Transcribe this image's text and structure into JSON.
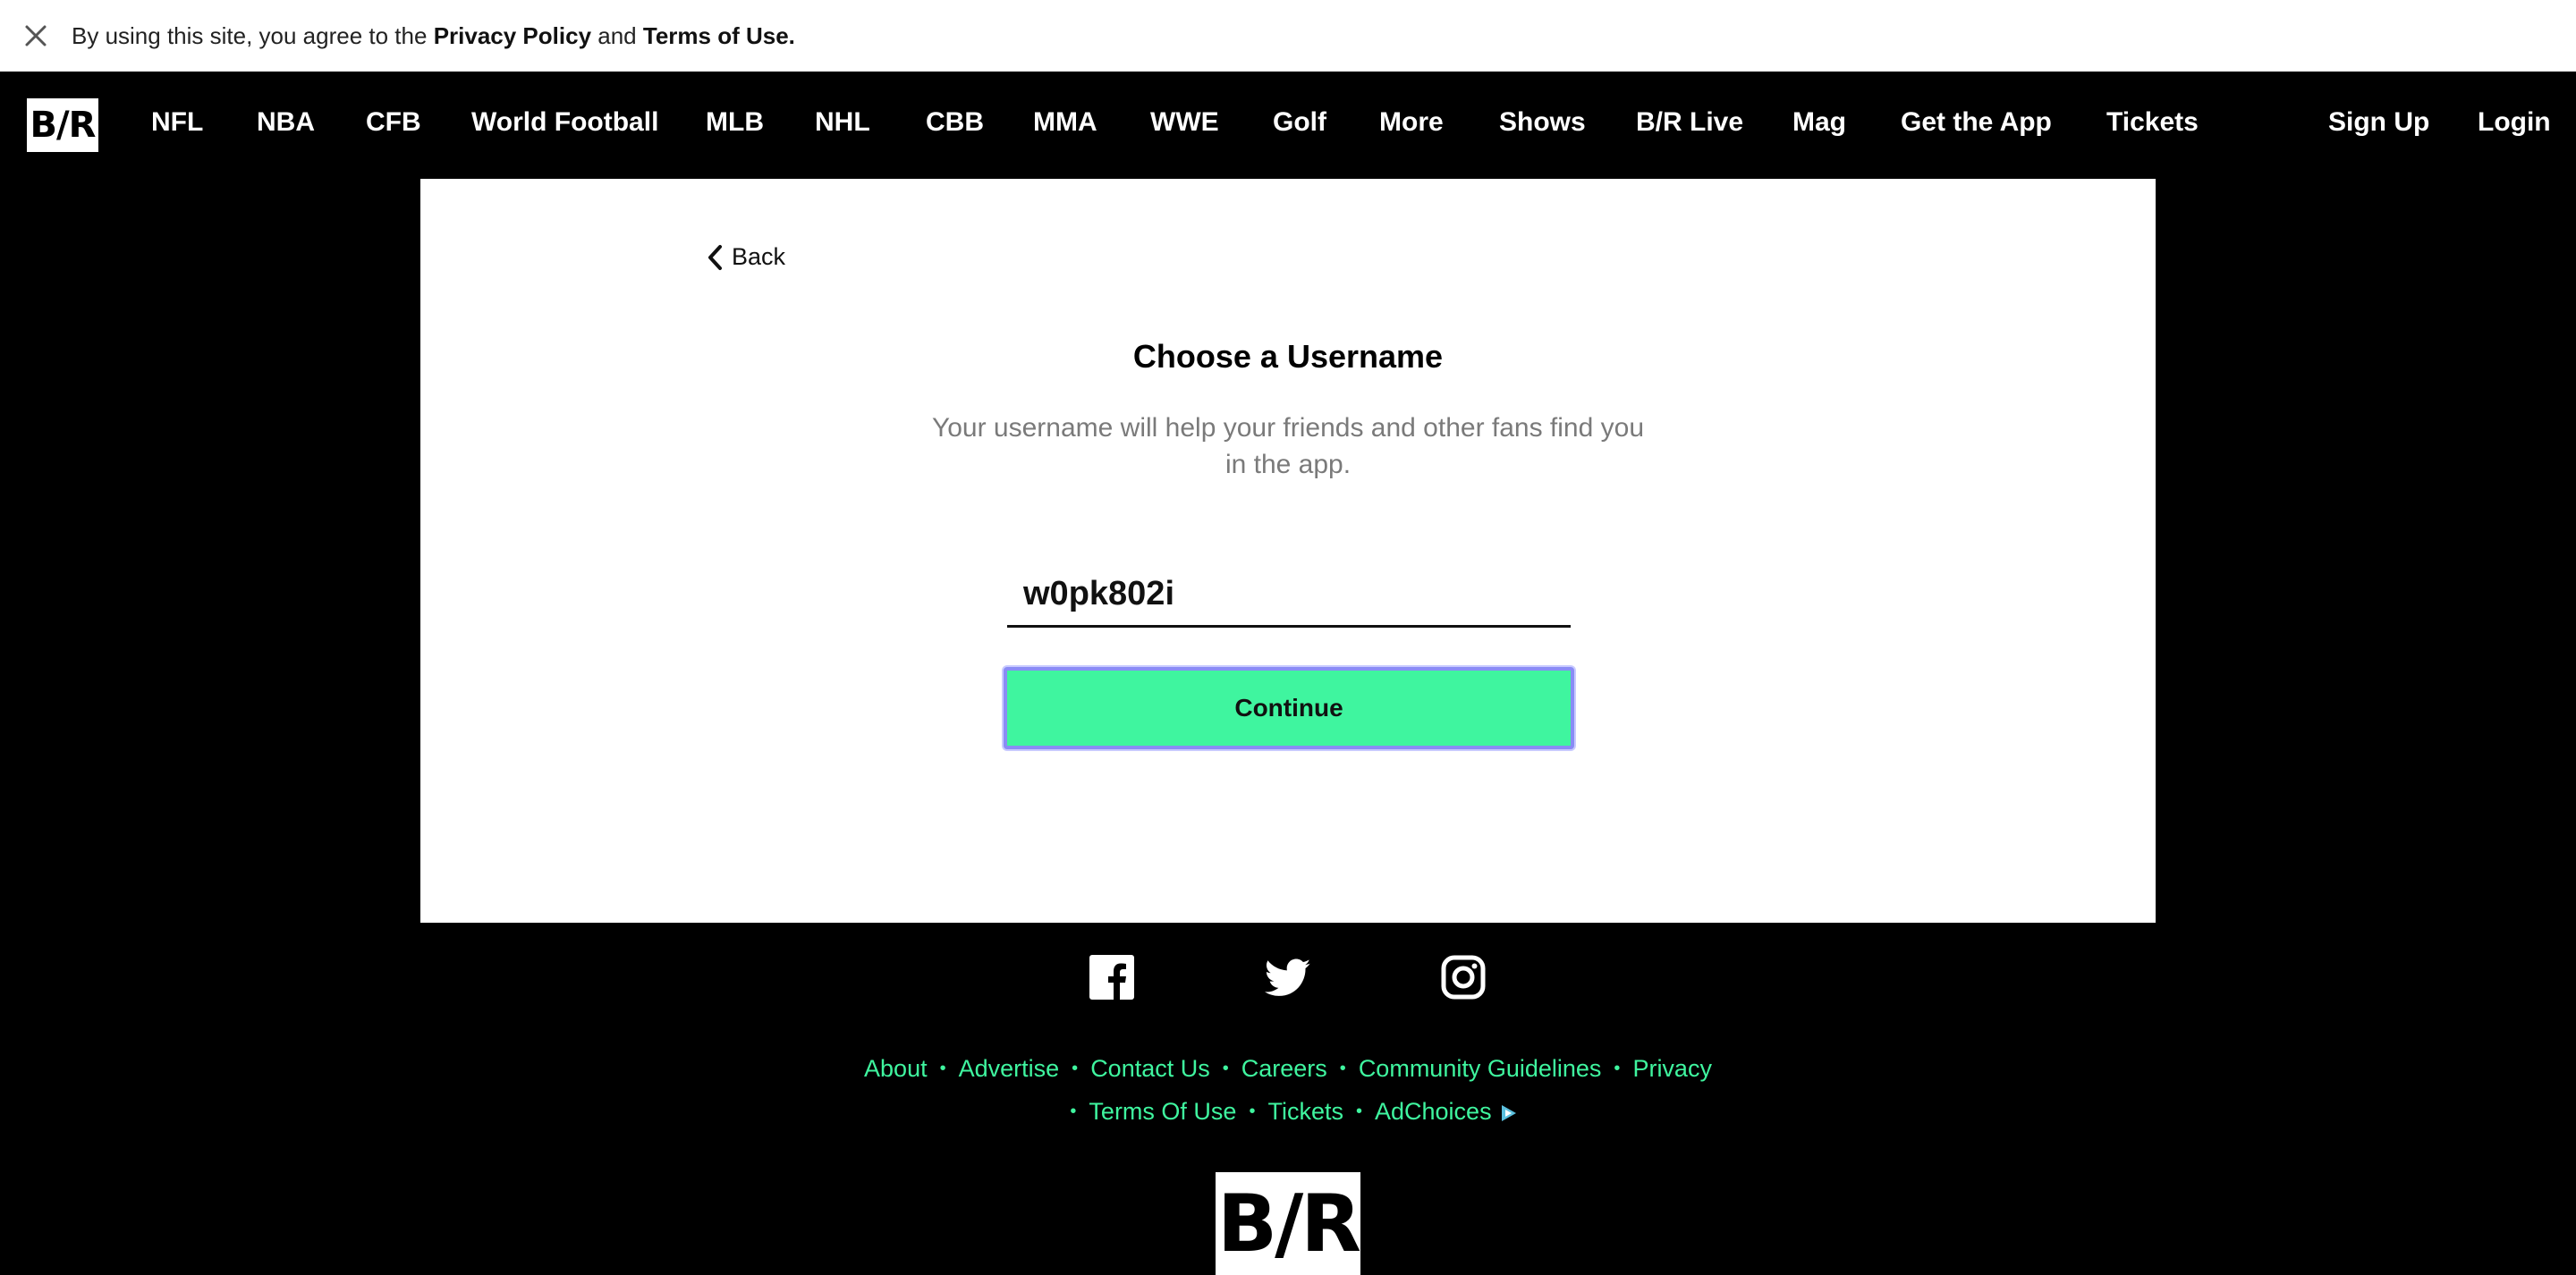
{
  "consent": {
    "prefix": "By using this site, you agree to the",
    "privacy_link": "Privacy Policy",
    "and": "and",
    "terms_link": "Terms of Use."
  },
  "nav": {
    "logo": "B/R",
    "items": [
      "NFL",
      "NBA",
      "CFB",
      "World Football",
      "MLB",
      "NHL",
      "CBB",
      "MMA",
      "WWE",
      "Golf",
      "More",
      "Shows",
      "B/R Live",
      "Mag",
      "Get the App",
      "Tickets"
    ],
    "signup": "Sign Up",
    "login": "Login"
  },
  "form": {
    "back_label": "Back",
    "title": "Choose a Username",
    "subtitle": "Your username will help your friends and other fans find you in the app.",
    "username_value": "w0pk802i",
    "continue_label": "Continue"
  },
  "footer": {
    "social": [
      "facebook-icon",
      "twitter-icon",
      "instagram-icon"
    ],
    "links_row1": [
      "About",
      "Advertise",
      "Contact Us",
      "Careers",
      "Community Guidelines",
      "Privacy"
    ],
    "links_row2": [
      "Terms Of Use",
      "Tickets",
      "AdChoices"
    ],
    "logo": "B/R"
  },
  "colors": {
    "accent": "#3ff59f",
    "focus_ring": "#8a8cf5",
    "background": "#000000"
  }
}
